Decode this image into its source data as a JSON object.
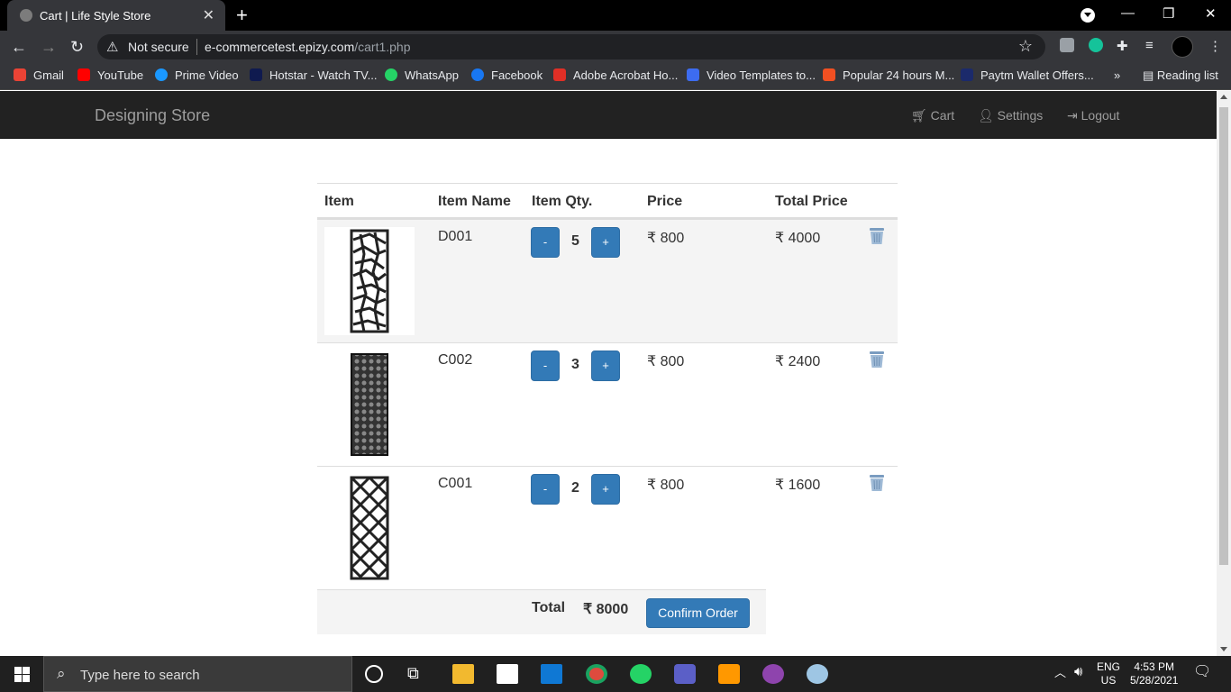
{
  "browser": {
    "tab_title": "Cart | Life Style Store",
    "address_security": "Not secure",
    "address_host": "e-commercetest.epizy.com",
    "address_path": "/cart1.php",
    "bookmarks": [
      "Gmail",
      "YouTube",
      "Prime Video",
      "Hotstar - Watch TV...",
      "WhatsApp",
      "Facebook",
      "Adobe Acrobat Ho...",
      "Video Templates to...",
      "Popular 24 hours M...",
      "Paytm Wallet Offers..."
    ],
    "bookmarks_more": "»",
    "reading_list": "Reading list"
  },
  "site": {
    "brand": "Designing Store",
    "nav": {
      "cart": "Cart",
      "settings": "Settings",
      "logout": "Logout"
    }
  },
  "cart": {
    "headers": [
      "Item",
      "Item Name",
      "Item Qty.",
      "Price",
      "Total Price"
    ],
    "items": [
      {
        "name": "D001",
        "qty": "5",
        "price": "₹ 800",
        "total": "₹ 4000"
      },
      {
        "name": "C002",
        "qty": "3",
        "price": "₹ 800",
        "total": "₹ 2400"
      },
      {
        "name": "C001",
        "qty": "2",
        "price": "₹ 800",
        "total": "₹ 1600"
      }
    ],
    "minus_label": "-",
    "plus_label": "+",
    "total_label": "Total",
    "total_value": "₹ 8000",
    "confirm_label": "Confirm Order"
  },
  "taskbar": {
    "search_placeholder": "Type here to search",
    "lang_top": "ENG",
    "lang_bottom": "US",
    "time": "4:53 PM",
    "date": "5/28/2021"
  },
  "colors": {
    "navbar": "#222222",
    "primary": "#337ab7",
    "browser_bg": "#35363a"
  }
}
